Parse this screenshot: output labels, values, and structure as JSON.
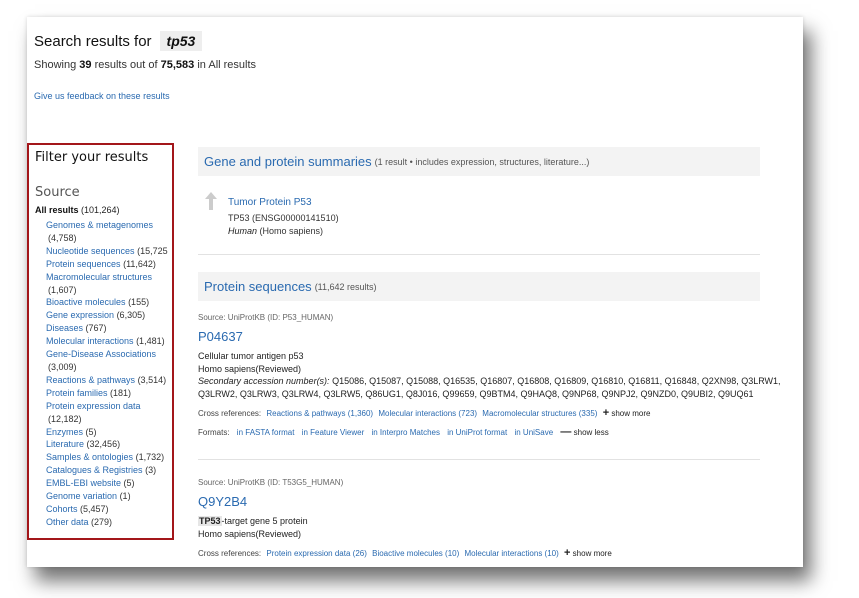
{
  "search": {
    "prefix": "Search results for",
    "term": "tp53",
    "showing_prefix": "Showing",
    "count": "39",
    "mid": "results out of",
    "total": "75,583",
    "suffix": "in All results",
    "feedback": "Give us feedback on these results"
  },
  "filter": {
    "title": "Filter your results",
    "source_title": "Source",
    "all_label": "All results",
    "all_count": "(101,264)",
    "items": [
      {
        "label": "Genomes & metagenomes",
        "count": "(4,758)",
        "wrap": true
      },
      {
        "label": "Nucleotide sequences",
        "count": "(15,725",
        "wrap": false
      },
      {
        "label": "Protein sequences",
        "count": "(11,642)",
        "wrap": false
      },
      {
        "label": "Macromolecular structures",
        "count": "(1,607)",
        "wrap": true
      },
      {
        "label": "Bioactive molecules",
        "count": "(155)",
        "wrap": false
      },
      {
        "label": "Gene expression",
        "count": "(6,305)",
        "wrap": false
      },
      {
        "label": "Diseases",
        "count": "(767)",
        "wrap": false
      },
      {
        "label": "Molecular interactions",
        "count": "(1,481)",
        "wrap": false
      },
      {
        "label": "Gene-Disease Associations",
        "count": "(3,009)",
        "wrap": true
      },
      {
        "label": "Reactions & pathways",
        "count": "(3,514)",
        "wrap": false
      },
      {
        "label": "Protein families",
        "count": "(181)",
        "wrap": false
      },
      {
        "label": "Protein expression data",
        "count": "(12,182)",
        "wrap": true
      },
      {
        "label": "Enzymes",
        "count": "(5)",
        "wrap": false
      },
      {
        "label": "Literature",
        "count": "(32,456)",
        "wrap": false
      },
      {
        "label": "Samples & ontologies",
        "count": "(1,732)",
        "wrap": false
      },
      {
        "label": "Catalogues & Registries",
        "count": "(3)",
        "wrap": false
      },
      {
        "label": "EMBL-EBI website",
        "count": "(5)",
        "wrap": false
      },
      {
        "label": "Genome variation",
        "count": "(1)",
        "wrap": false
      },
      {
        "label": "Cohorts",
        "count": "(5,457)",
        "wrap": false
      },
      {
        "label": "Other data",
        "count": "(279)",
        "wrap": false
      }
    ]
  },
  "gene_section": {
    "title": "Gene and protein summaries",
    "subtitle": "(1 result • includes expression, structures, literature...)",
    "icon": "arrow-up-icon",
    "name": "Tumor Protein P53",
    "id_line": "TP53 (ENSG00000141510)",
    "species_common": "Human",
    "species_latin": "(Homo sapiens)"
  },
  "protein_section": {
    "title": "Protein sequences",
    "subtitle": "(11,642 results)"
  },
  "entry1": {
    "source": "Source: UniProtKB (ID: P53_HUMAN)",
    "accession": "P04637",
    "name": "Cellular tumor antigen p53",
    "organism": "Homo sapiens(Reviewed)",
    "secondary_label": "Secondary accession number(s):",
    "secondary_line1": "Q15086, Q15087, Q15088, Q16535, Q16807, Q16808, Q16809, Q16810, Q16811, Q16848, Q2XN98, Q3LRW1,",
    "secondary_line2": "Q3LRW2, Q3LRW3, Q3LRW4, Q3LRW5, Q86UG1, Q8J016, Q99659, Q9BTM4, Q9HAQ8, Q9NP68, Q9NPJ2, Q9NZD0, Q9UBI2, Q9UQ61",
    "cross_label": "Cross references:",
    "cross_refs": [
      "Reactions & pathways (1,360)",
      "Molecular interactions (723)",
      "Macromolecular structures (335)"
    ],
    "show_more": "show more",
    "formats_label": "Formats:",
    "formats": [
      "in FASTA format",
      "in Feature Viewer",
      "in Interpro Matches",
      "in UniProt format",
      "in UniSave"
    ],
    "show_less": "show less"
  },
  "entry2": {
    "source": "Source: UniProtKB (ID: T53G5_HUMAN)",
    "accession": "Q9Y2B4",
    "name_tag": "TP53",
    "name_rest": "-target gene 5 protein",
    "organism": "Homo sapiens(Reviewed)",
    "cross_label": "Cross references:",
    "cross_refs": [
      "Protein expression data (26)",
      "Bioactive molecules (10)",
      "Molecular interactions (10)"
    ],
    "show_more": "show more"
  },
  "colors": {
    "link": "#2a6ab0",
    "highlight_border": "#a3161a",
    "section_bg": "#f3f3f3"
  }
}
